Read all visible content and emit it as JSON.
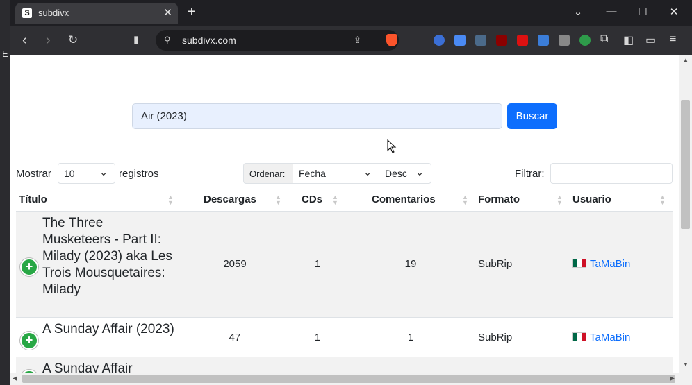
{
  "browser": {
    "tab_title": "subdivx",
    "tab_favicon": "S",
    "url": "subdivx.com",
    "left_strip_letter": "E"
  },
  "search": {
    "value": "Air (2023)",
    "button": "Buscar"
  },
  "controls": {
    "show_label": "Mostrar",
    "show_value": "10",
    "records_label": "registros",
    "order_label": "Ordenar:",
    "order_by": "Fecha",
    "order_dir": "Desc",
    "filter_label": "Filtrar:",
    "filter_value": ""
  },
  "table": {
    "headers": [
      "Título",
      "Descargas",
      "CDs",
      "Comentarios",
      "Formato",
      "Usuario"
    ],
    "rows": [
      {
        "title": "The Three Musketeers - Part II: Milady (2023) aka Les Trois Mousquetaires: Milady",
        "downloads": "2059",
        "cds": "1",
        "comments": "19",
        "format": "SubRip",
        "user": "TaMaBin"
      },
      {
        "title": "A Sunday Affair (2023)",
        "downloads": "47",
        "cds": "1",
        "comments": "1",
        "format": "SubRip",
        "user": "TaMaBin"
      },
      {
        "title": "A Sunday Affair",
        "downloads": "",
        "cds": "",
        "comments": "",
        "format": "",
        "user": ""
      }
    ]
  },
  "colors": {
    "accent": "#0d6efd",
    "add_button": "#28a745",
    "row_stripe": "#f2f2f2"
  }
}
